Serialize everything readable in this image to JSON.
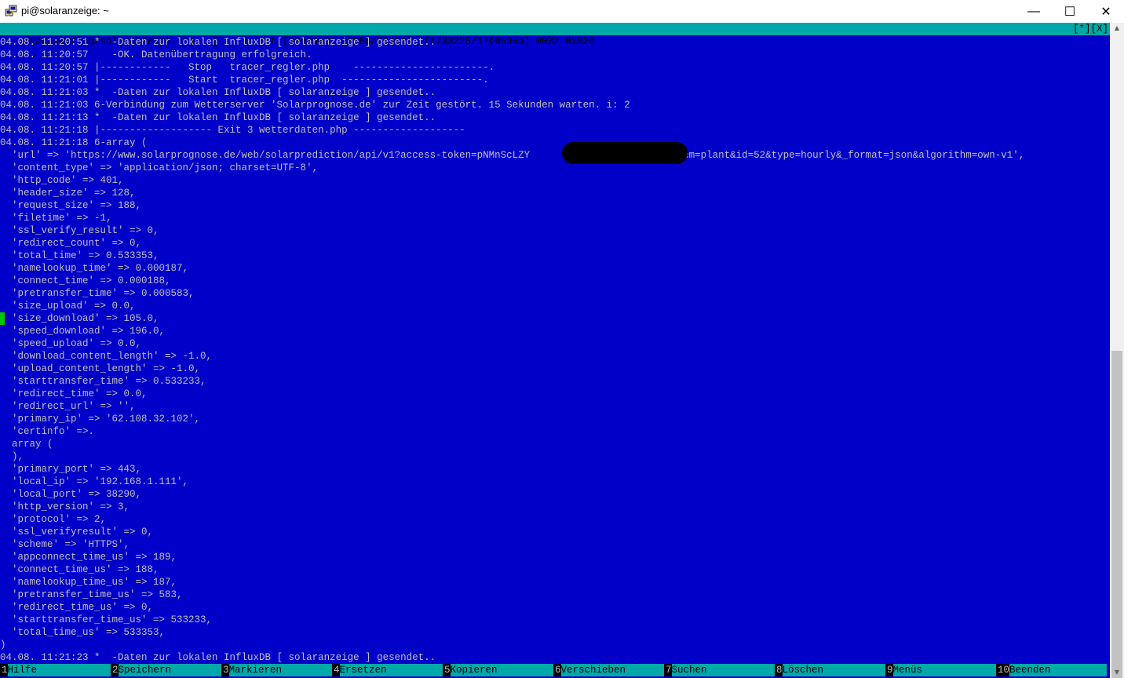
{
  "window": {
    "title": "pi@solaranzeige: ~",
    "icon": "putty-icon",
    "minimize_glyph": "—",
    "maximize_glyph": "☐",
    "close_glyph": "✕"
  },
  "editor": {
    "status_left": "/var/www/log/solaranzeige.log   [----]  0 L:[28936+22 28958/29462] *(1733228/1769595b) 0032 0x020",
    "status_right": "[*][X]"
  },
  "log_lines": [
    "04.08. 11:20:51 *  -Daten zur lokalen InfluxDB [ solaranzeige ] gesendet..",
    "04.08. 11:20:57    -OK. Datenübertragung erfolgreich.",
    "04.08. 11:20:57 |------------   Stop   tracer_regler.php    -----------------------.",
    "04.08. 11:21:01 |------------   Start  tracer_regler.php  ------------------------.",
    "04.08. 11:21:03 *  -Daten zur lokalen InfluxDB [ solaranzeige ] gesendet..",
    "04.08. 11:21:03 6-Verbindung zum Wetterserver 'Solarprognose.de' zur Zeit gestört. 15 Sekunden warten. i: 2",
    "04.08. 11:21:13 *  -Daten zur lokalen InfluxDB [ solaranzeige ] gesendet..",
    "04.08. 11:21:18 |------------------- Exit 3 wetterdaten.php -------------------",
    "04.08. 11:21:18 6-array (",
    "  'url' => 'https://www.solarprognose.de/web/solarprediction/api/v1?access-token=pNMnScLZY                    A3i&item=plant&id=52&type=hourly&_format=json&algorithm=own-v1',",
    "  'content_type' => 'application/json; charset=UTF-8',",
    "  'http_code' => 401,",
    "  'header_size' => 128,",
    "  'request_size' => 188,",
    "  'filetime' => -1,",
    "  'ssl_verify_result' => 0,",
    "  'redirect_count' => 0,",
    "  'total_time' => 0.533353,",
    "  'namelookup_time' => 0.000187,",
    "  'connect_time' => 0.000188,",
    "  'pretransfer_time' => 0.000583,",
    "  'size_upload' => 0.0,",
    "  'size_download' => 105.0,",
    "  'speed_download' => 196.0,",
    "  'speed_upload' => 0.0,",
    "  'download_content_length' => -1.0,",
    "  'upload_content_length' => -1.0,",
    "  'starttransfer_time' => 0.533233,",
    "  'redirect_time' => 0.0,",
    "  'redirect_url' => '',",
    "  'primary_ip' => '62.108.32.102',",
    "  'certinfo' =>.",
    "  array (",
    "  ),",
    "  'primary_port' => 443,",
    "  'local_ip' => '192.168.1.111',",
    "  'local_port' => 38290,",
    "  'http_version' => 3,",
    "  'protocol' => 2,",
    "  'ssl_verifyresult' => 0,",
    "  'scheme' => 'HTTPS',",
    "  'appconnect_time_us' => 189,",
    "  'connect_time_us' => 188,",
    "  'namelookup_time_us' => 187,",
    "  'pretransfer_time_us' => 583,",
    "  'redirect_time_us' => 0,",
    "  'starttransfer_time_us' => 533233,",
    "  'total_time_us' => 533353,",
    ")",
    "04.08. 11:21:23 *  -Daten zur lokalen InfluxDB [ solaranzeige ] gesendet.."
  ],
  "function_keys": [
    {
      "num": "1",
      "label": "Hilfe"
    },
    {
      "num": "2",
      "label": "Speichern"
    },
    {
      "num": "3",
      "label": "Markieren"
    },
    {
      "num": "4",
      "label": "Ersetzen"
    },
    {
      "num": "5",
      "label": "Kopieren"
    },
    {
      "num": "6",
      "label": "Verschieben"
    },
    {
      "num": "7",
      "label": "Suchen"
    },
    {
      "num": "8",
      "label": "Löschen"
    },
    {
      "num": "9",
      "label": "Menüs"
    },
    {
      "num": "10",
      "label": "Beenden"
    }
  ],
  "scrollbar": {
    "position_fraction": 0.5
  },
  "colors": {
    "terminal_bg": "#0000c8",
    "terminal_fg": "#c0c0c0",
    "status_bg": "#00a8a8",
    "cursor": "#00c800"
  }
}
